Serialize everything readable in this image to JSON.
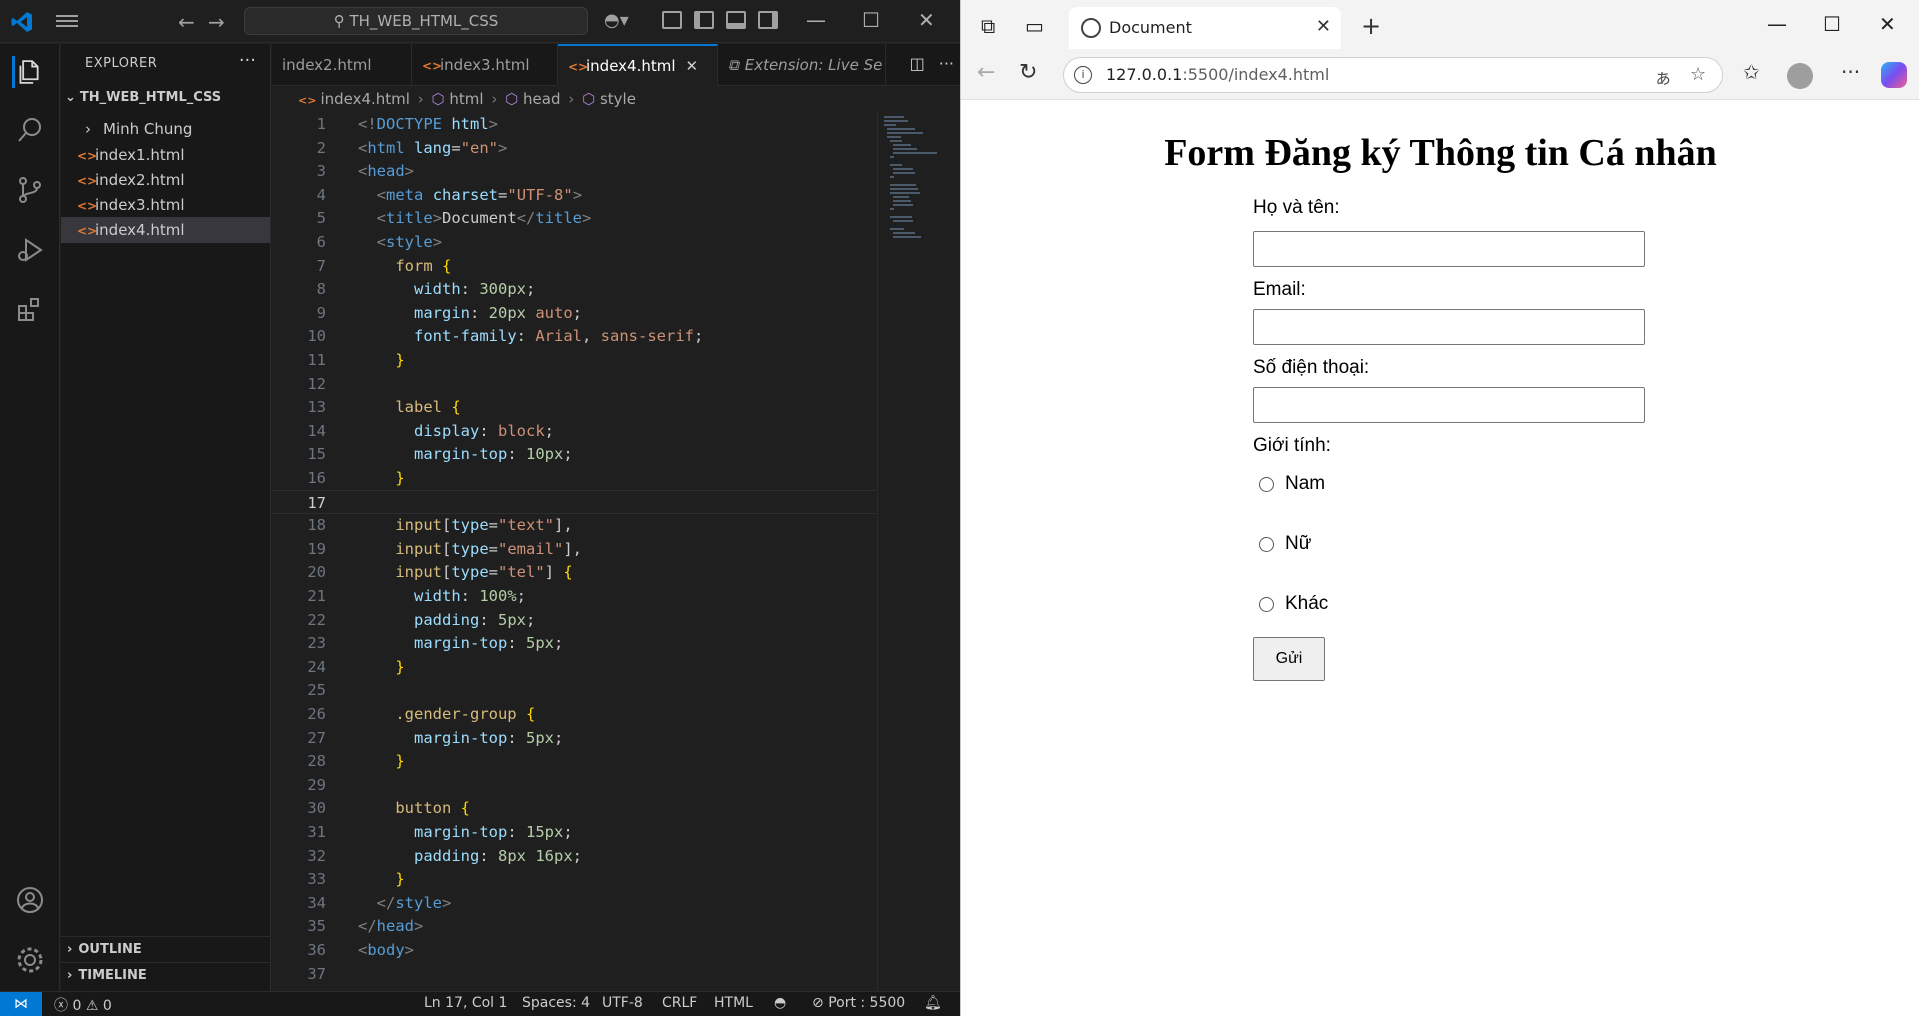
{
  "vscode": {
    "search": "TH_WEB_HTML_CSS",
    "explorer_title": "EXPLORER",
    "folder": "TH_WEB_HTML_CSS",
    "tree": [
      {
        "label": "Minh Chung",
        "kind": "folder"
      },
      {
        "label": "index1.html",
        "kind": "file"
      },
      {
        "label": "index2.html",
        "kind": "file"
      },
      {
        "label": "index3.html",
        "kind": "file"
      },
      {
        "label": "index4.html",
        "kind": "file",
        "selected": true
      }
    ],
    "outline": "OUTLINE",
    "timeline": "TIMELINE",
    "tabs": [
      {
        "label": "index2.html"
      },
      {
        "label": "index3.html"
      },
      {
        "label": "index4.html",
        "active": true
      },
      {
        "label": "Extension: Live Se"
      }
    ],
    "breadcrumb": [
      "index4.html",
      "html",
      "head",
      "style"
    ],
    "current_line": 17,
    "status": {
      "errors": "0",
      "warnings": "0",
      "position": "Ln 17, Col 1",
      "spaces": "Spaces: 4",
      "encoding": "UTF-8",
      "eol": "CRLF",
      "language": "HTML",
      "port": "Port : 5500"
    }
  },
  "browser": {
    "tab_title": "Document",
    "url_host": "127.0.0.1",
    "url_rest": ":5500/index4.html",
    "page": {
      "heading": "Form Đăng ký Thông tin Cá nhân",
      "name_label": "Họ và tên:",
      "email_label": "Email:",
      "phone_label": "Số điện thoại:",
      "gender_label": "Giới tính:",
      "genders": [
        "Nam",
        "Nữ",
        "Khác"
      ],
      "submit": "Gửi"
    }
  },
  "code_lines": [
    [
      [
        "c-punc",
        "<!"
      ],
      [
        "c-tag",
        "DOCTYPE"
      ],
      [
        "c-txt",
        " "
      ],
      [
        "c-attr",
        "html"
      ],
      [
        "c-punc",
        ">"
      ]
    ],
    [
      [
        "c-punc",
        "<"
      ],
      [
        "c-tag",
        "html"
      ],
      [
        "c-txt",
        " "
      ],
      [
        "c-attr",
        "lang"
      ],
      [
        "c-txt",
        "="
      ],
      [
        "c-str",
        "\"en\""
      ],
      [
        "c-punc",
        ">"
      ]
    ],
    [
      [
        "c-punc",
        "<"
      ],
      [
        "c-tag",
        "head"
      ],
      [
        "c-punc",
        ">"
      ]
    ],
    [
      [
        "c-txt",
        "  "
      ],
      [
        "c-punc",
        "<"
      ],
      [
        "c-tag",
        "meta"
      ],
      [
        "c-txt",
        " "
      ],
      [
        "c-attr",
        "charset"
      ],
      [
        "c-txt",
        "="
      ],
      [
        "c-str",
        "\"UTF-8\""
      ],
      [
        "c-punc",
        ">"
      ]
    ],
    [
      [
        "c-txt",
        "  "
      ],
      [
        "c-punc",
        "<"
      ],
      [
        "c-tag",
        "title"
      ],
      [
        "c-punc",
        ">"
      ],
      [
        "c-txt",
        "Document"
      ],
      [
        "c-punc",
        "</"
      ],
      [
        "c-tag",
        "title"
      ],
      [
        "c-punc",
        ">"
      ]
    ],
    [
      [
        "c-txt",
        "  "
      ],
      [
        "c-punc",
        "<"
      ],
      [
        "c-tag",
        "style"
      ],
      [
        "c-punc",
        ">"
      ]
    ],
    [
      [
        "c-txt",
        "    "
      ],
      [
        "c-sel",
        "form"
      ],
      [
        "c-txt",
        " "
      ],
      [
        "c-brace",
        "{"
      ]
    ],
    [
      [
        "c-txt",
        "      "
      ],
      [
        "c-prop",
        "width"
      ],
      [
        "c-txt",
        ": "
      ],
      [
        "c-num",
        "300px"
      ],
      [
        "c-txt",
        ";"
      ]
    ],
    [
      [
        "c-txt",
        "      "
      ],
      [
        "c-prop",
        "margin"
      ],
      [
        "c-txt",
        ": "
      ],
      [
        "c-num",
        "20px"
      ],
      [
        "c-txt",
        " "
      ],
      [
        "c-val",
        "auto"
      ],
      [
        "c-txt",
        ";"
      ]
    ],
    [
      [
        "c-txt",
        "      "
      ],
      [
        "c-prop",
        "font-family"
      ],
      [
        "c-txt",
        ": "
      ],
      [
        "c-val",
        "Arial"
      ],
      [
        "c-txt",
        ", "
      ],
      [
        "c-val",
        "sans-serif"
      ],
      [
        "c-txt",
        ";"
      ]
    ],
    [
      [
        "c-txt",
        "    "
      ],
      [
        "c-brace",
        "}"
      ]
    ],
    [],
    [
      [
        "c-txt",
        "    "
      ],
      [
        "c-sel",
        "label"
      ],
      [
        "c-txt",
        " "
      ],
      [
        "c-brace",
        "{"
      ]
    ],
    [
      [
        "c-txt",
        "      "
      ],
      [
        "c-prop",
        "display"
      ],
      [
        "c-txt",
        ": "
      ],
      [
        "c-val",
        "block"
      ],
      [
        "c-txt",
        ";"
      ]
    ],
    [
      [
        "c-txt",
        "      "
      ],
      [
        "c-prop",
        "margin-top"
      ],
      [
        "c-txt",
        ": "
      ],
      [
        "c-num",
        "10px"
      ],
      [
        "c-txt",
        ";"
      ]
    ],
    [
      [
        "c-txt",
        "    "
      ],
      [
        "c-brace",
        "}"
      ]
    ],
    [],
    [
      [
        "c-txt",
        "    "
      ],
      [
        "c-sel",
        "input"
      ],
      [
        "c-txt",
        "["
      ],
      [
        "c-attr",
        "type"
      ],
      [
        "c-txt",
        "="
      ],
      [
        "c-str",
        "\"text\""
      ],
      [
        "c-txt",
        "],"
      ]
    ],
    [
      [
        "c-txt",
        "    "
      ],
      [
        "c-sel",
        "input"
      ],
      [
        "c-txt",
        "["
      ],
      [
        "c-attr",
        "type"
      ],
      [
        "c-txt",
        "="
      ],
      [
        "c-str",
        "\"email\""
      ],
      [
        "c-txt",
        "],"
      ]
    ],
    [
      [
        "c-txt",
        "    "
      ],
      [
        "c-sel",
        "input"
      ],
      [
        "c-txt",
        "["
      ],
      [
        "c-attr",
        "type"
      ],
      [
        "c-txt",
        "="
      ],
      [
        "c-str",
        "\"tel\""
      ],
      [
        "c-txt",
        "] "
      ],
      [
        "c-brace",
        "{"
      ]
    ],
    [
      [
        "c-txt",
        "      "
      ],
      [
        "c-prop",
        "width"
      ],
      [
        "c-txt",
        ": "
      ],
      [
        "c-num",
        "100%"
      ],
      [
        "c-txt",
        ";"
      ]
    ],
    [
      [
        "c-txt",
        "      "
      ],
      [
        "c-prop",
        "padding"
      ],
      [
        "c-txt",
        ": "
      ],
      [
        "c-num",
        "5px"
      ],
      [
        "c-txt",
        ";"
      ]
    ],
    [
      [
        "c-txt",
        "      "
      ],
      [
        "c-prop",
        "margin-top"
      ],
      [
        "c-txt",
        ": "
      ],
      [
        "c-num",
        "5px"
      ],
      [
        "c-txt",
        ";"
      ]
    ],
    [
      [
        "c-txt",
        "    "
      ],
      [
        "c-brace",
        "}"
      ]
    ],
    [],
    [
      [
        "c-txt",
        "    "
      ],
      [
        "c-sel",
        ".gender-group"
      ],
      [
        "c-txt",
        " "
      ],
      [
        "c-brace",
        "{"
      ]
    ],
    [
      [
        "c-txt",
        "      "
      ],
      [
        "c-prop",
        "margin-top"
      ],
      [
        "c-txt",
        ": "
      ],
      [
        "c-num",
        "5px"
      ],
      [
        "c-txt",
        ";"
      ]
    ],
    [
      [
        "c-txt",
        "    "
      ],
      [
        "c-brace",
        "}"
      ]
    ],
    [],
    [
      [
        "c-txt",
        "    "
      ],
      [
        "c-sel",
        "button"
      ],
      [
        "c-txt",
        " "
      ],
      [
        "c-brace",
        "{"
      ]
    ],
    [
      [
        "c-txt",
        "      "
      ],
      [
        "c-prop",
        "margin-top"
      ],
      [
        "c-txt",
        ": "
      ],
      [
        "c-num",
        "15px"
      ],
      [
        "c-txt",
        ";"
      ]
    ],
    [
      [
        "c-txt",
        "      "
      ],
      [
        "c-prop",
        "padding"
      ],
      [
        "c-txt",
        ": "
      ],
      [
        "c-num",
        "8px"
      ],
      [
        "c-txt",
        " "
      ],
      [
        "c-num",
        "16px"
      ],
      [
        "c-txt",
        ";"
      ]
    ],
    [
      [
        "c-txt",
        "    "
      ],
      [
        "c-brace",
        "}"
      ]
    ],
    [
      [
        "c-txt",
        "  "
      ],
      [
        "c-punc",
        "</"
      ],
      [
        "c-tag",
        "style"
      ],
      [
        "c-punc",
        ">"
      ]
    ],
    [
      [
        "c-punc",
        "</"
      ],
      [
        "c-tag",
        "head"
      ],
      [
        "c-punc",
        ">"
      ]
    ],
    [
      [
        "c-punc",
        "<"
      ],
      [
        "c-tag",
        "body"
      ],
      [
        "c-punc",
        ">"
      ]
    ],
    []
  ]
}
